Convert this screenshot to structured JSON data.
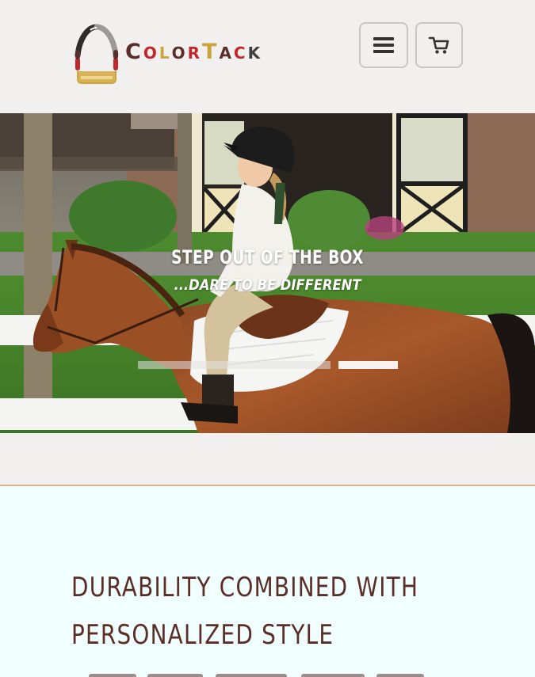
{
  "header": {
    "logo": {
      "letters": [
        {
          "char": "C",
          "size": "big",
          "color": "#5c2e2a"
        },
        {
          "char": "o",
          "size": "small",
          "color": "#c0282c"
        },
        {
          "char": "l",
          "size": "small",
          "color": "#caa43c"
        },
        {
          "char": "o",
          "size": "small",
          "color": "#5c2e2a"
        },
        {
          "char": "r",
          "size": "small",
          "color": "#c0282c"
        },
        {
          "char": "T",
          "size": "big",
          "color": "#caa43c"
        },
        {
          "char": "a",
          "size": "small",
          "color": "#5c2e2a"
        },
        {
          "char": "c",
          "size": "small",
          "color": "#c0282c"
        },
        {
          "char": "k",
          "size": "small",
          "color": "#3f3f3f"
        }
      ],
      "icon": "stirrup-logo-icon"
    },
    "menu_button": {
      "icon": "hamburger-menu-icon"
    },
    "cart_button": {
      "icon": "shopping-cart-icon"
    }
  },
  "hero": {
    "title": "STEP OUT OF THE BOX",
    "subtitle": "...DARE TO BE DIFFERENT",
    "image": "child-riding-chestnut-pony-photo",
    "slider_indicators": 2,
    "active_slide": 2
  },
  "content": {
    "headline_line1": "DURABILITY COMBINED WITH",
    "headline_line2": "PERSONALIZED STYLE"
  },
  "colors": {
    "brand_brown": "#5a2e25",
    "accent_gold": "#d5b593",
    "page_bg": "#f2f0ee",
    "content_bg": "#f0feff"
  }
}
